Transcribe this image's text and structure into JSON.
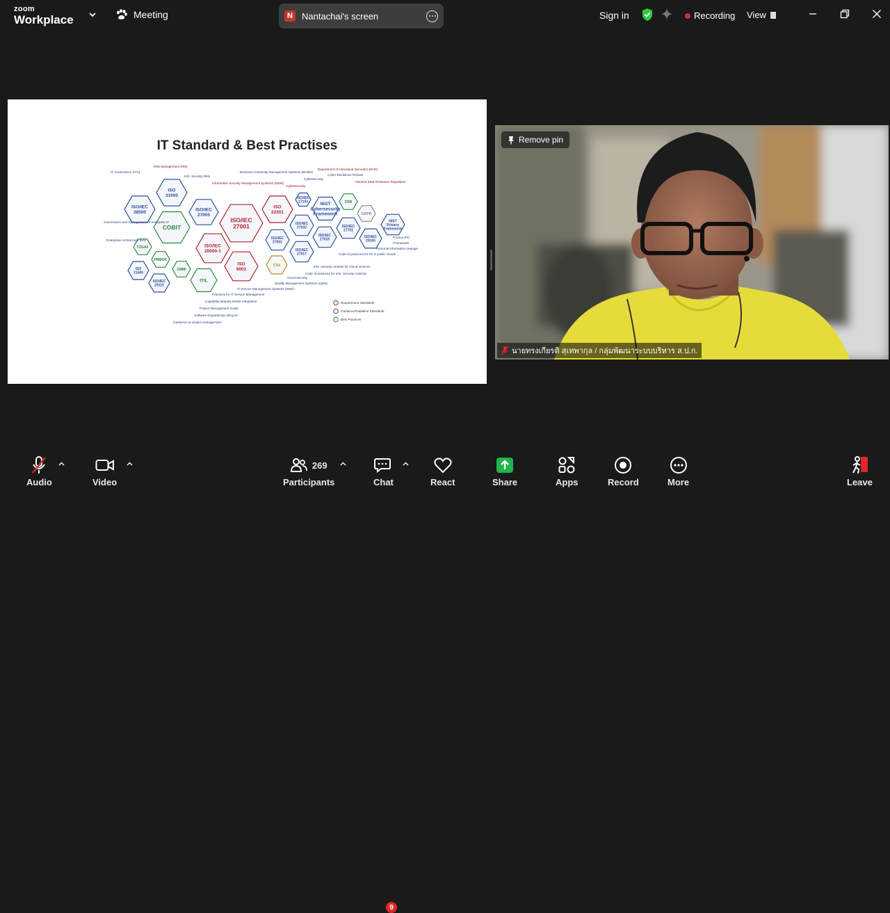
{
  "app": {
    "logo_small": "zoom",
    "logo_big": "Workplace",
    "meeting_label": "Meeting",
    "share_initial": "N",
    "share_label": "Nantachai's screen",
    "sign_in": "Sign in",
    "recording": "Recording",
    "view": "View"
  },
  "slide": {
    "title": "IT Standard & Best Practises",
    "hexes": [
      {
        "label": "ISO\n31000",
        "color": "#2a4fa0"
      },
      {
        "label": "ISO/IEC\n38500",
        "color": "#2a4fa0"
      },
      {
        "label": "COBIT",
        "color": "#2a8a3a"
      },
      {
        "label": "ISO/IEC\n27005",
        "color": "#2a4fa0"
      },
      {
        "label": "ISO/IEC\n27001",
        "color": "#b0202a"
      },
      {
        "label": "ISO/IEC\n20000-1",
        "color": "#b0202a"
      },
      {
        "label": "ISO\n9001",
        "color": "#b0202a"
      },
      {
        "label": "ISO\n22301",
        "color": "#b0202a"
      },
      {
        "label": "ISO/IEC\n27002",
        "color": "#2a4fa0"
      },
      {
        "label": "ISO/IEC\n27032",
        "color": "#2a4fa0"
      },
      {
        "label": "ISO/IEC\n27017",
        "color": "#2a4fa0"
      },
      {
        "label": "ISO/IEC\n27018",
        "color": "#2a4fa0"
      },
      {
        "label": "NIST\nCybersecurity\nFramework",
        "color": "#2a4fa0"
      },
      {
        "label": "CRR",
        "color": "#2a8a3a"
      },
      {
        "label": "GDPR",
        "color": "#888888"
      },
      {
        "label": "ISO/IEC\n27701",
        "color": "#2a4fa0"
      },
      {
        "label": "ISO/IEC\n29100",
        "color": "#2a4fa0"
      },
      {
        "label": "NIST\nPrivacy\nFramework",
        "color": "#2a4fa0"
      },
      {
        "label": "TOGAF",
        "color": "#2a8a3a"
      },
      {
        "label": "PMBOK",
        "color": "#2a8a3a"
      },
      {
        "label": "ISO\n21500",
        "color": "#2a4fa0"
      },
      {
        "label": "ISO/IEC\n29110",
        "color": "#2a4fa0"
      },
      {
        "label": "CMMI",
        "color": "#2a8a3a"
      },
      {
        "label": "ITIL",
        "color": "#2a8a3a"
      },
      {
        "label": "CSA",
        "color": "#c08a20"
      },
      {
        "label": "ISO/IEC\n27103",
        "color": "#2a4fa0"
      }
    ],
    "annotations": [
      "IT Governance (ITG)",
      "Risk Management (RM)",
      "Info. Security Risk",
      "Information Security Management Systems (ISMS)",
      "Business Continuity Management Systems (BCMS)",
      "Cybersecurity",
      "Cybersecurity",
      "Department of Homeland Security's (DHS)",
      "Cyber Resilience Review",
      "General Data Protection Regulation",
      "Governance and management of enterprise IT",
      "Enterprise Architecture (EA)",
      "Privacy (PI)",
      "Framework",
      "Personal information management",
      "Code of practices for PII in public clouds",
      "Info. security controls for Cloud services",
      "Code of practices for Info. Security controls",
      "Cloud security",
      "Quality Management Systems (QMS)",
      "IT Service Management Systems (SMS)",
      "Practices for IT Service Management",
      "Capability Maturity Model Integration",
      "Project Management Guide",
      "Software Engineering Lifecycle",
      "Guidance on project management"
    ],
    "legend": [
      "Requirement Standards",
      "Guidance/Guideline Standards",
      "Best Practices"
    ]
  },
  "video": {
    "remove_pin": "Remove pin",
    "participant_name": "นายทรงเกียรติ สุเทพากุล / กลุ่มพัฒนาระบบบริหาร ส.ป.ก."
  },
  "toolbar": {
    "audio": "Audio",
    "video": "Video",
    "participants": "Participants",
    "participants_count": "269",
    "chat": "Chat",
    "chat_badge": "9",
    "react": "React",
    "share": "Share",
    "apps": "Apps",
    "record": "Record",
    "more": "More",
    "leave": "Leave"
  },
  "colors": {
    "share_green": "#1fb34a",
    "rec_red": "#e02828",
    "shield_green": "#2ecc40",
    "shirt_yellow": "#e5dc3a"
  }
}
